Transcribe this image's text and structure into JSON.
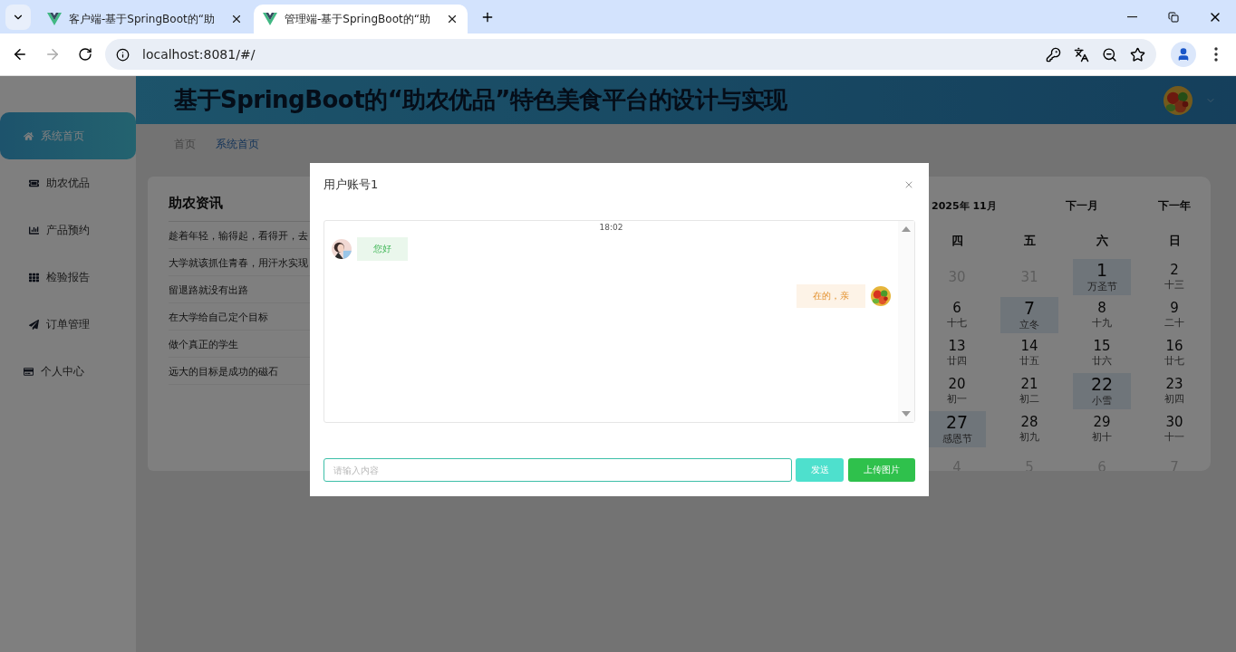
{
  "browser": {
    "tabs": [
      {
        "title": "客户端-基于SpringBoot的“助",
        "selected": false
      },
      {
        "title": "管理端-基于SpringBoot的“助",
        "selected": true
      }
    ],
    "url": "localhost:8081/#/"
  },
  "header": {
    "title": "基于SpringBoot的“助农优品”特色美食平台的设计与实现"
  },
  "sidebar": {
    "items": [
      {
        "label": "系统首页",
        "selected": true
      },
      {
        "label": "助农优品",
        "selected": false
      },
      {
        "label": "产品预约",
        "selected": false
      },
      {
        "label": "检验报告",
        "selected": false
      },
      {
        "label": "订单管理",
        "selected": false
      },
      {
        "label": "个人中心",
        "selected": false
      }
    ]
  },
  "breadcrumb": [
    {
      "label": "首页",
      "current": false
    },
    {
      "label": "系统首页",
      "current": true
    }
  ],
  "news": {
    "title": "助农资讯",
    "items": [
      "趁着年轻，输得起，看得开，去",
      "大学就该抓住青春，用汗水实现",
      "留退路就没有出路",
      "在大学给自己定个目标",
      "做个真正的学生",
      "远大的目标是成功的磁石"
    ]
  },
  "calendar": {
    "month_label": "2025年 11月",
    "next_month": "下一月",
    "next_year": "下一年",
    "weekdays": [
      "四",
      "五",
      "六",
      "日"
    ],
    "weeks": [
      [
        {
          "day": "30",
          "other_month": true,
          "marked": false
        },
        {
          "day": "31",
          "other_month": true,
          "marked": false
        },
        {
          "day": "1",
          "lunar": "万圣节",
          "other_month": false,
          "marked": true
        },
        {
          "day": "2",
          "lunar": "十三",
          "other_month": false,
          "marked": false
        }
      ],
      [
        {
          "day": "6",
          "lunar": "十七",
          "other_month": false,
          "marked": false
        },
        {
          "day": "7",
          "lunar": "立冬",
          "other_month": false,
          "marked": true
        },
        {
          "day": "8",
          "lunar": "十九",
          "other_month": false,
          "marked": false
        },
        {
          "day": "9",
          "lunar": "二十",
          "other_month": false,
          "marked": false
        }
      ],
      [
        {
          "day": "13",
          "lunar": "廿四",
          "other_month": false,
          "marked": false
        },
        {
          "day": "14",
          "lunar": "廿五",
          "other_month": false,
          "marked": false
        },
        {
          "day": "15",
          "lunar": "廿六",
          "other_month": false,
          "marked": false
        },
        {
          "day": "16",
          "lunar": "廿七",
          "other_month": false,
          "marked": false
        }
      ],
      [
        {
          "day": "20",
          "lunar": "初一",
          "other_month": false,
          "marked": false
        },
        {
          "day": "21",
          "lunar": "初二",
          "other_month": false,
          "marked": false
        },
        {
          "day": "22",
          "lunar": "小雪",
          "other_month": false,
          "marked": true
        },
        {
          "day": "23",
          "lunar": "初四",
          "other_month": false,
          "marked": false
        }
      ],
      [
        {
          "day": "27",
          "lunar": "感恩节",
          "other_month": false,
          "marked": true
        },
        {
          "day": "28",
          "lunar": "初九",
          "other_month": false,
          "marked": false
        },
        {
          "day": "29",
          "lunar": "初十",
          "other_month": false,
          "marked": false
        },
        {
          "day": "30",
          "lunar": "十一",
          "other_month": false,
          "marked": false
        }
      ],
      [
        {
          "day": "4",
          "other_month": true,
          "marked": false
        },
        {
          "day": "5",
          "other_month": true,
          "marked": false
        },
        {
          "day": "6",
          "other_month": true,
          "marked": false
        },
        {
          "day": "7",
          "other_month": true,
          "marked": false
        }
      ]
    ]
  },
  "dialog": {
    "title": "用户账号1",
    "time": "18:02",
    "messages": [
      {
        "kind": "received",
        "text": "您好"
      },
      {
        "kind": "sent",
        "text": "在的，亲"
      }
    ],
    "input": {
      "placeholder": "请输入内容"
    },
    "buttons": [
      {
        "label": "发送",
        "kind": "send"
      },
      {
        "label": "上传图片",
        "kind": "upload"
      }
    ]
  }
}
